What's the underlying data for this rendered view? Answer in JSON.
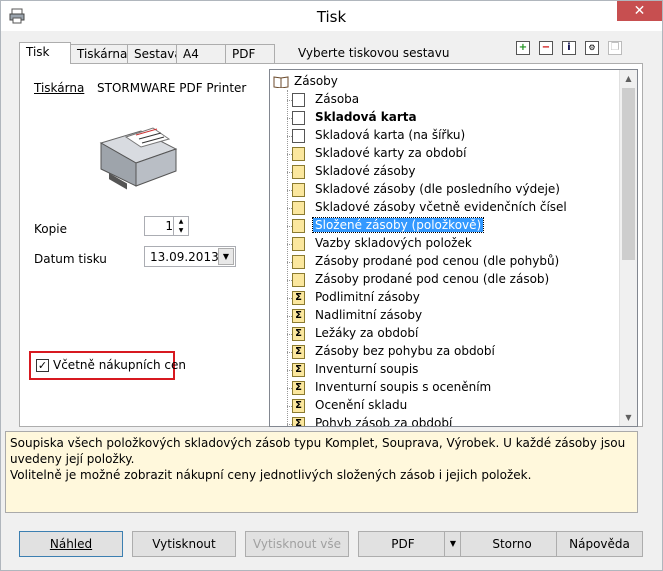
{
  "window": {
    "title": "Tisk"
  },
  "tabs": [
    {
      "label": "Tisk"
    },
    {
      "label": "Tiskárna"
    },
    {
      "label": "Sestava"
    },
    {
      "label": "A4"
    },
    {
      "label": "PDF"
    }
  ],
  "report_label": "Vyberte tiskovou sestavu",
  "printer": {
    "label": "Tiskárna",
    "name": "STORMWARE PDF Printer"
  },
  "copies": {
    "label": "Kopie",
    "value": "1"
  },
  "print_date": {
    "label": "Datum tisku",
    "value": "13.09.2013"
  },
  "purchase_prices": {
    "label": "Včetně nákupních cen",
    "checked": true
  },
  "tree": {
    "root": "Zásoby",
    "items": [
      {
        "label": "Zásoba",
        "icon": "doc"
      },
      {
        "label": "Skladová karta",
        "icon": "doc",
        "bold": true
      },
      {
        "label": "Skladová karta (na šířku)",
        "icon": "doc"
      },
      {
        "label": "Skladové karty za období",
        "icon": "yellow"
      },
      {
        "label": "Skladové zásoby",
        "icon": "yellow"
      },
      {
        "label": "Skladové zásoby (dle posledního výdeje)",
        "icon": "yellow"
      },
      {
        "label": "Skladové zásoby včetně evidenčních čísel",
        "icon": "yellow"
      },
      {
        "label": "Složené zásoby (položkově)",
        "icon": "yellow",
        "selected": true
      },
      {
        "label": "Vazby skladových položek",
        "icon": "yellow"
      },
      {
        "label": "Zásoby prodané pod cenou (dle pohybů)",
        "icon": "yellow"
      },
      {
        "label": "Zásoby prodané pod cenou (dle zásob)",
        "icon": "yellow"
      },
      {
        "label": "Podlimitní zásoby",
        "icon": "sum"
      },
      {
        "label": "Nadlimitní zásoby",
        "icon": "sum"
      },
      {
        "label": "Ležáky za období",
        "icon": "sum"
      },
      {
        "label": "Zásoby bez pohybu za období",
        "icon": "sum"
      },
      {
        "label": "Inventurní soupis",
        "icon": "sum"
      },
      {
        "label": "Inventurní soupis s oceněním",
        "icon": "sum"
      },
      {
        "label": "Ocenění skladu",
        "icon": "sum"
      },
      {
        "label": "Pohyb zásob za období",
        "icon": "sum"
      }
    ]
  },
  "description": {
    "line1": "Soupiska všech položkových skladových zásob typu Komplet, Souprava, Výrobek. U každé zásoby jsou uvedeny její položky.",
    "line2": "Volitelně je možné zobrazit nákupní ceny jednotlivých složených zásob i jejich položek."
  },
  "buttons": {
    "preview": "Náhled",
    "print": "Vytisknout",
    "print_all": "Vytisknout vše",
    "pdf": "PDF",
    "cancel": "Storno",
    "help": "Nápověda"
  }
}
